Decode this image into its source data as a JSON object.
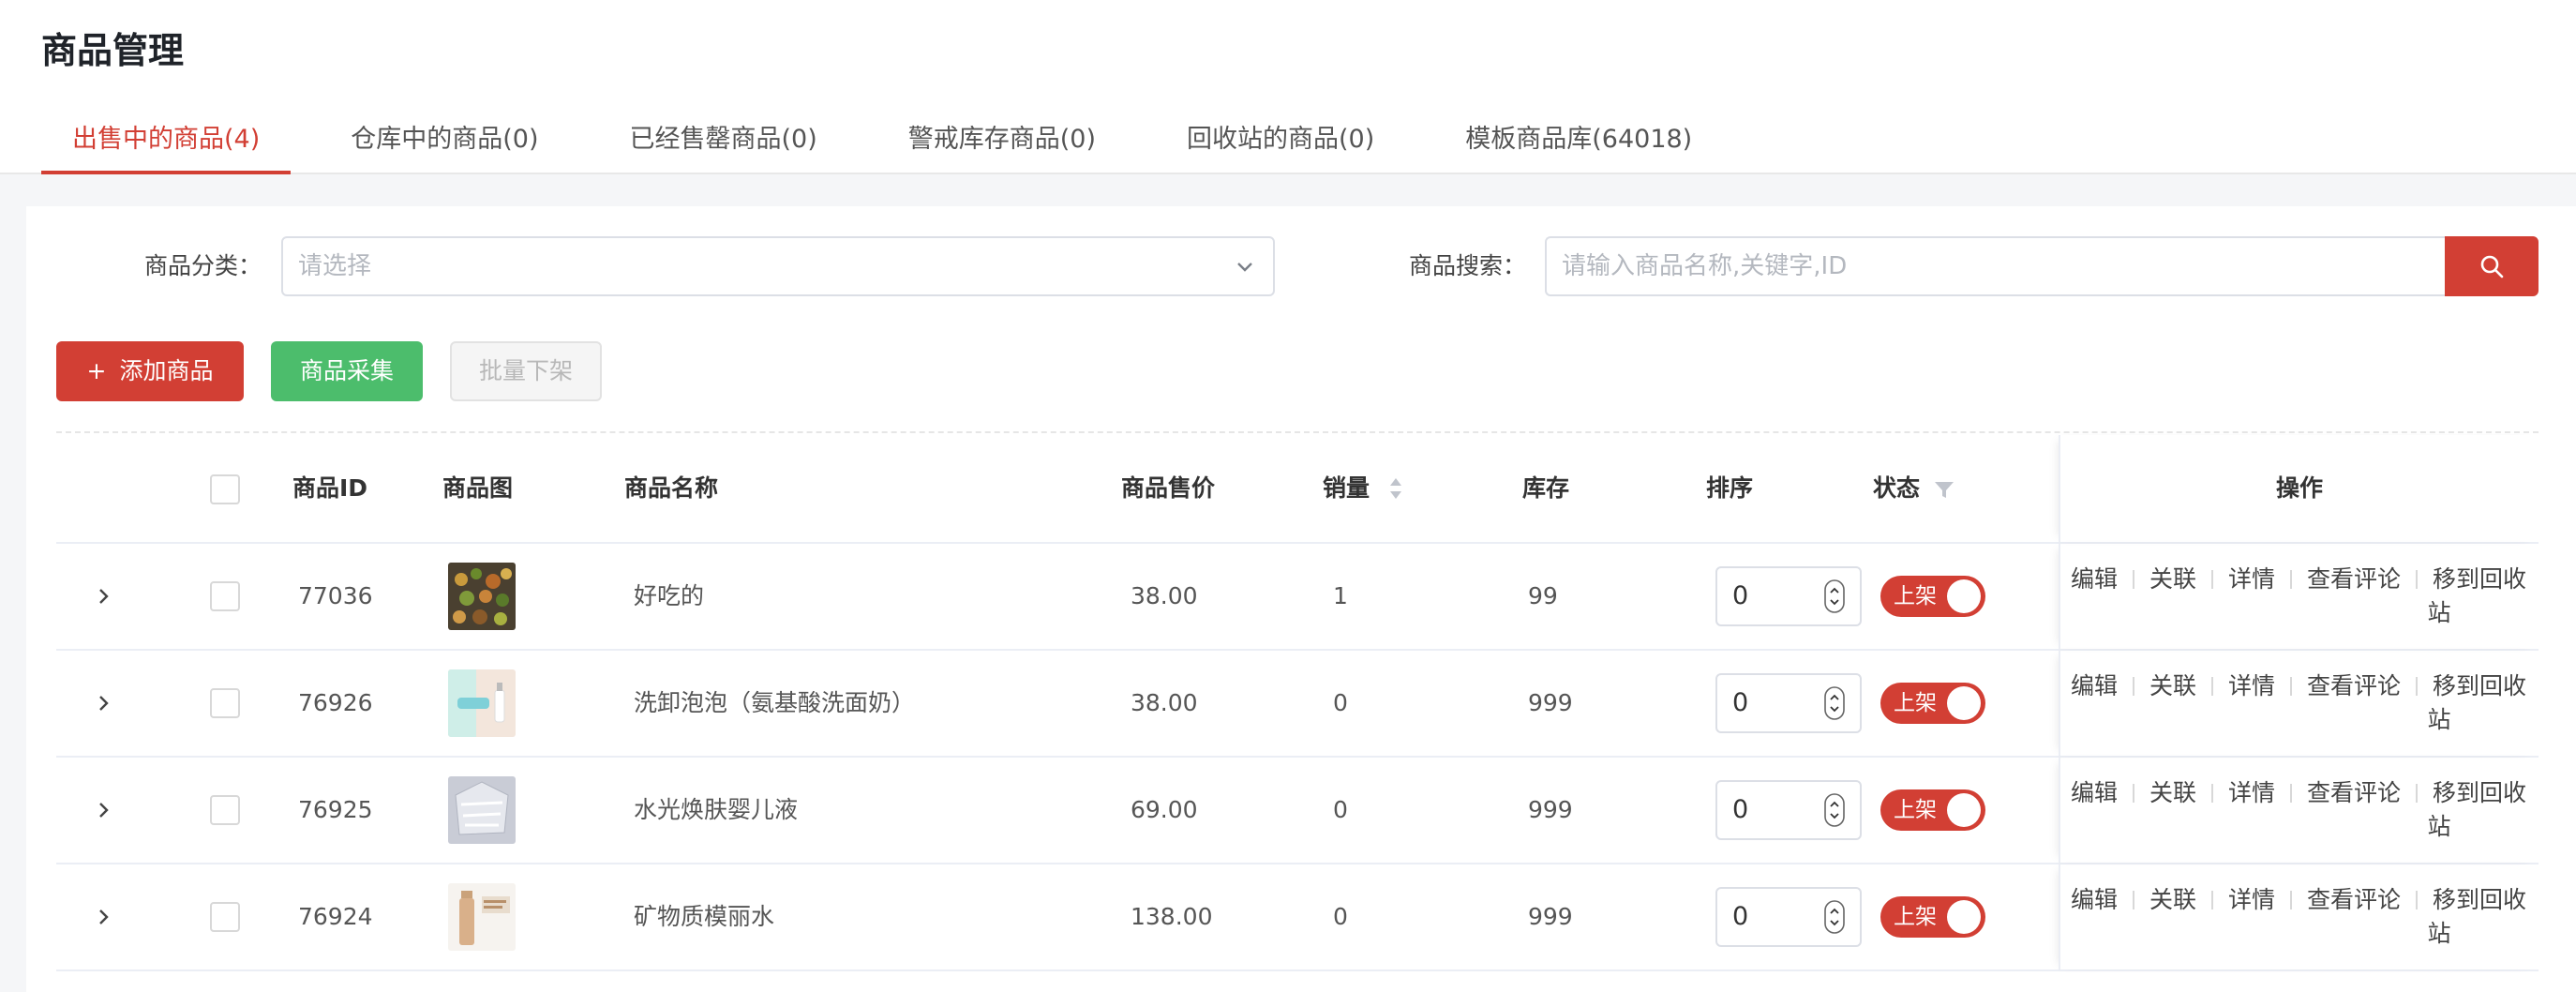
{
  "page": {
    "title": "商品管理"
  },
  "tabs": [
    {
      "label": "出售中的商品(4)"
    },
    {
      "label": "仓库中的商品(0)"
    },
    {
      "label": "已经售罄商品(0)"
    },
    {
      "label": "警戒库存商品(0)"
    },
    {
      "label": "回收站的商品(0)"
    },
    {
      "label": "模板商品库(64018)"
    }
  ],
  "filter": {
    "category_label": "商品分类：",
    "category_placeholder": "请选择",
    "search_label": "商品搜索：",
    "search_placeholder": "请输入商品名称,关键字,ID"
  },
  "actions": {
    "add": "添加商品",
    "add_icon": "+",
    "collect": "商品采集",
    "batch_off": "批量下架"
  },
  "table": {
    "headers": {
      "id": "商品ID",
      "image": "商品图",
      "name": "商品名称",
      "price": "商品售价",
      "sales": "销量",
      "stock": "库存",
      "sort": "排序",
      "status": "状态",
      "ops": "操作"
    },
    "rows": [
      {
        "id": "77036",
        "name": "好吃的",
        "price": "38.00",
        "sales": "1",
        "stock": "99",
        "sort": "0",
        "status": "上架",
        "thumb": "food"
      },
      {
        "id": "76926",
        "name": "洗卸泡泡（氨基酸洗面奶）",
        "price": "38.00",
        "sales": "0",
        "stock": "999",
        "sort": "0",
        "status": "上架",
        "thumb": "cleanser"
      },
      {
        "id": "76925",
        "name": "水光焕肤婴儿液",
        "price": "69.00",
        "sales": "0",
        "stock": "999",
        "sort": "0",
        "status": "上架",
        "thumb": "serum"
      },
      {
        "id": "76924",
        "name": "矿物质模丽水",
        "price": "138.00",
        "sales": "0",
        "stock": "999",
        "sort": "0",
        "status": "上架",
        "thumb": "bottle"
      }
    ],
    "ops": {
      "edit": "编辑",
      "link": "关联",
      "detail": "详情",
      "reviews": "查看评论",
      "recycle_a": "移到回收",
      "recycle_b": "站"
    }
  },
  "colors": {
    "accent": "#d23f34",
    "green": "#4cbd6c"
  }
}
